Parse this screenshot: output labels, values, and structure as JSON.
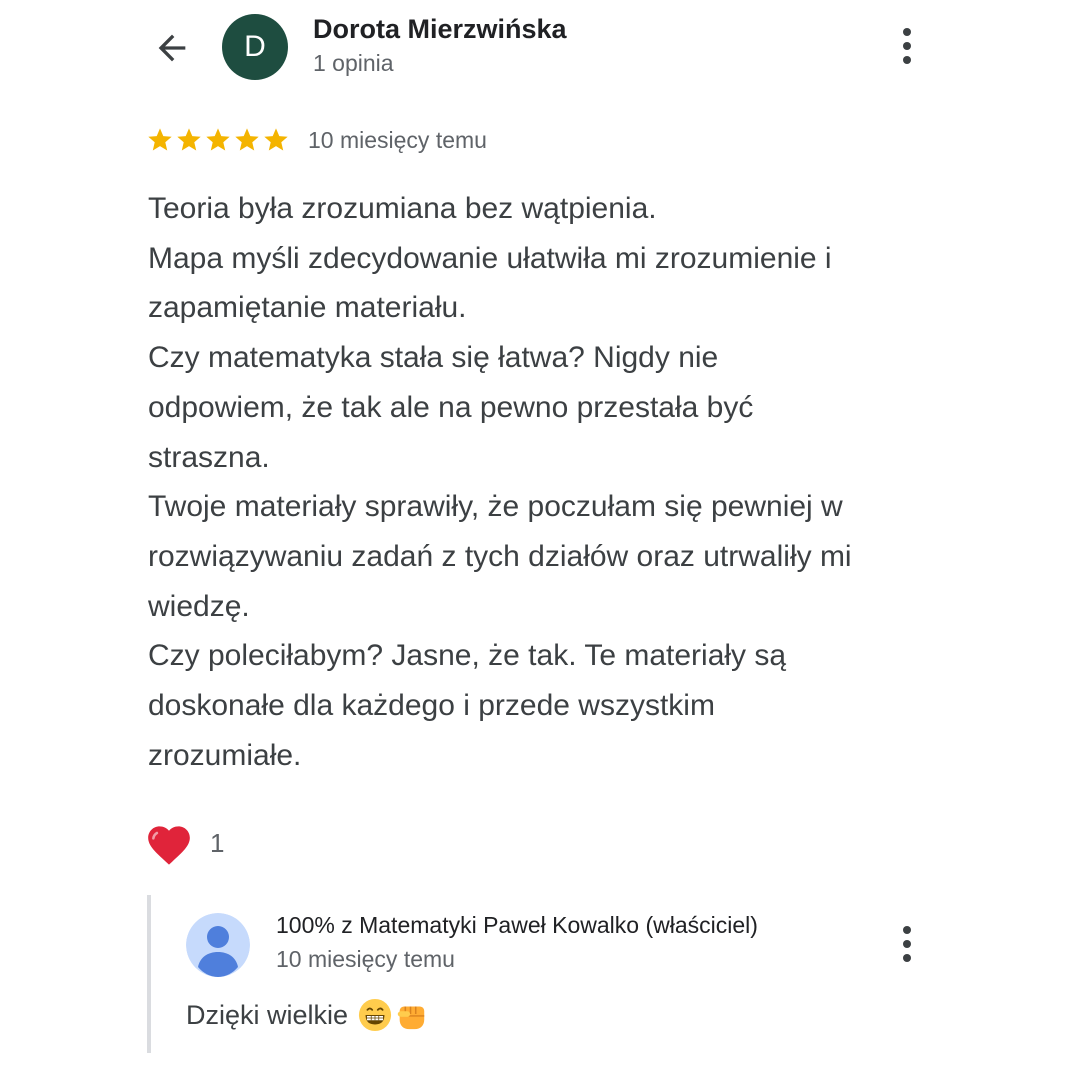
{
  "header": {
    "back_icon": "arrow-back-icon",
    "author": {
      "initial": "D",
      "name": "Dorota Mierzwińska",
      "meta": "1 opinia",
      "avatar_color": "#1e4d40"
    },
    "more_icon": "more-vert-icon"
  },
  "review": {
    "rating": 5,
    "rating_max": 5,
    "star_color": "#f4b400",
    "time": "10 miesięcy temu",
    "lines": [
      "Teoria była zrozumiana bez wątpienia.",
      "Mapa myśli zdecydowanie ułatwiła mi zrozumienie i",
      "zapamiętanie materiału.",
      "Czy matematyka stała się łatwa? Nigdy nie",
      "odpowiem, że tak ale na pewno przestała być",
      "straszna.",
      "Twoje materiały sprawiły, że poczułam się pewniej w",
      "rozwiązywaniu zadań z tych działów oraz utrwaliły mi",
      "wiedzę.",
      "Czy poleciłabym? Jasne, że tak. Te materiały są",
      "doskonałe dla każdego i przede wszystkim",
      "zrozumiałe."
    ]
  },
  "reaction": {
    "icon": "heart-icon",
    "count": "1",
    "color": "#e0243a"
  },
  "owner_reply": {
    "avatar_icon": "person-avatar-icon",
    "avatar_bg": "#c6dafc",
    "avatar_fg": "#4f7fdc",
    "name": "100% z Matematyki Paweł Kowalko (właściciel)",
    "time": "10 miesięcy temu",
    "text": "Dzięki wielkie",
    "emojis": [
      "grinning-face-icon",
      "fist-icon"
    ],
    "more_icon": "more-vert-icon"
  }
}
